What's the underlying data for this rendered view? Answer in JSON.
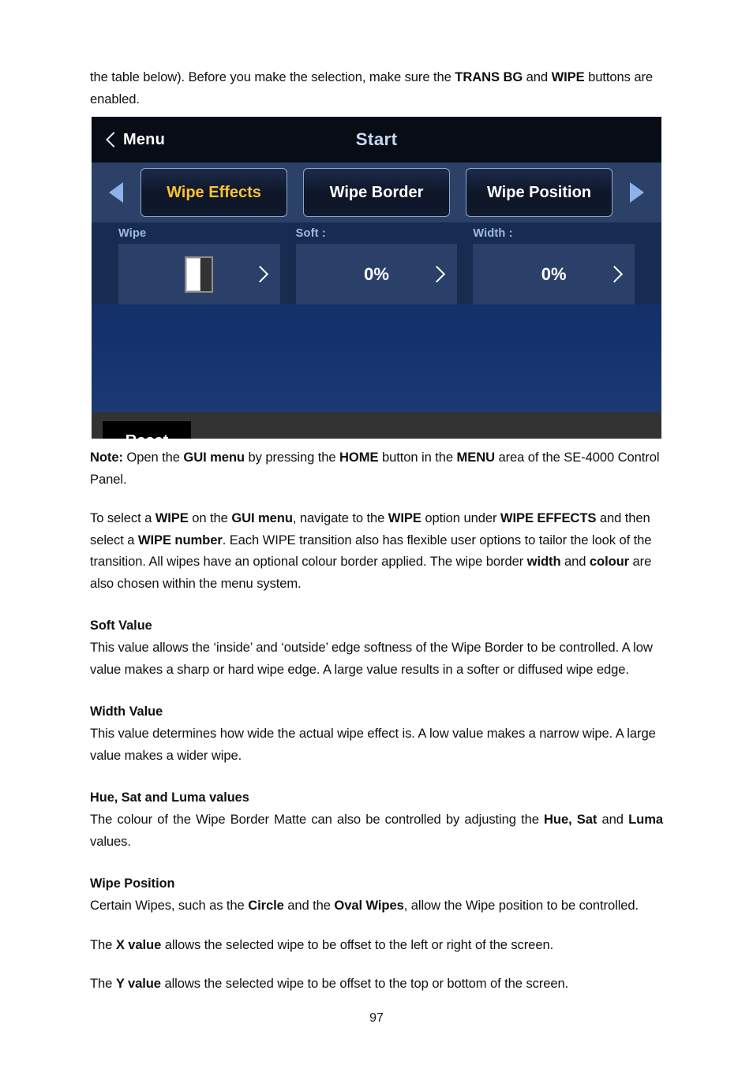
{
  "document": {
    "page_number": "97",
    "intro": {
      "line_html": "the table below).  Before you make the selection, make sure the <b>TRANS BG</b> and <b>WIPE</b> buttons are enabled."
    },
    "note": {
      "html": "<b>Note:</b> Open the <b>GUI menu</b> by pressing the <b>HOME</b> button in the <b>MENU</b> area of the SE-4000 Control Panel."
    },
    "select_wipe": {
      "html": "To select a <b>WIPE</b> on the <b>GUI menu</b>, navigate to the <b>WIPE</b> option under <b>WIPE EFFECTS</b> and then select a <b>WIPE number</b>. Each WIPE transition also has flexible user options to tailor the look of the transition. All wipes have an optional colour border applied. The wipe border <b>width</b> and <b>colour</b> are also chosen within the menu system."
    },
    "sections": [
      {
        "heading": "Soft Value",
        "body_html": "This value allows the ‘inside’ and ‘outside’ edge softness of the Wipe Border to be controlled. A low value makes a sharp or hard wipe edge. A large value results in a softer or diffused wipe edge."
      },
      {
        "heading": "Width Value",
        "body_html": "This value determines how wide the actual wipe effect is. A low value makes a narrow wipe. A large value makes a wider wipe."
      },
      {
        "heading": "Hue, Sat and Luma values",
        "body_html": "The colour of the Wipe Border Matte can also be controlled by adjusting the <b>Hue, Sat</b> and <b>Luma</b> values."
      },
      {
        "heading": "Wipe Position",
        "body_html": "Certain Wipes, such as the <b>Circle</b> and the <b>Oval Wipes</b>, allow the Wipe position to be controlled."
      }
    ],
    "x_value": {
      "html": "The <b>X value</b> allows the selected wipe to be offset to the left or right of the screen."
    },
    "y_value": {
      "html": "The <b>Y value</b> allows the selected wipe to be offset to the top or bottom of the screen."
    }
  },
  "device_ui": {
    "header": {
      "back_label": "Menu",
      "back_icon": "chevron-left-icon",
      "title": "Start"
    },
    "nav": {
      "prev_icon": "triangle-left-icon",
      "next_icon": "triangle-right-icon"
    },
    "tabs": [
      {
        "label": "Wipe Effects",
        "active": true
      },
      {
        "label": "Wipe Border",
        "active": false
      },
      {
        "label": "Wipe Position",
        "active": false
      }
    ],
    "params": [
      {
        "label": "Wipe",
        "value": "",
        "icon": "wipe-pattern-icon",
        "chevron": "chevron-right-icon"
      },
      {
        "label": "Soft :",
        "value": "0%",
        "icon": "",
        "chevron": "chevron-right-icon"
      },
      {
        "label": "Width :",
        "value": "0%",
        "icon": "",
        "chevron": "chevron-right-icon"
      }
    ],
    "footer": {
      "reset_label": "Reset"
    },
    "colors": {
      "header_bg": "#080c16",
      "title_text": "#c5daf2",
      "tabbar_bg": "#2c4168",
      "tab_bg": "#101a2e",
      "tab_border": "#8ba8cf",
      "tab_active_text": "#fcc233",
      "body_bg": "#15316b",
      "param_band_bg": "#182c52",
      "param_box_bg": "#2b4068",
      "param_label_text": "#9dbbe6",
      "footer_bg": "#333333",
      "reset_bg": "#000000",
      "arrow": "#8cb2e8"
    }
  }
}
